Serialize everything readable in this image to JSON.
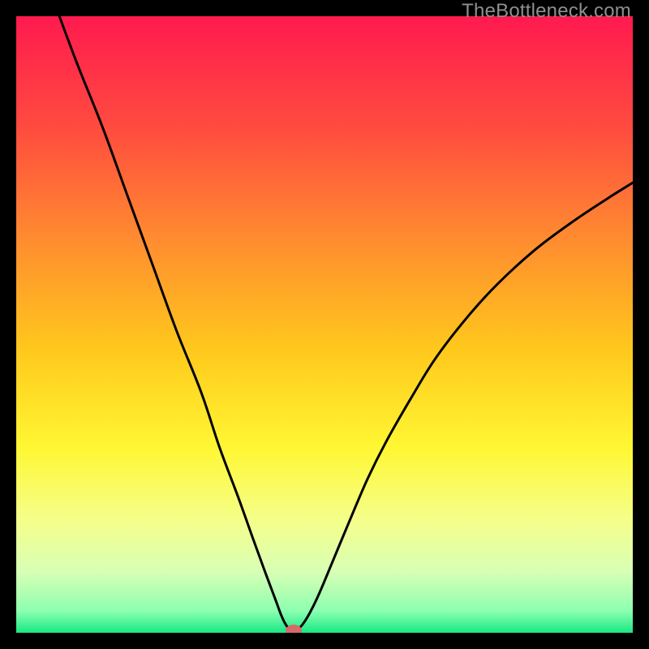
{
  "watermark": "TheBottleneck.com",
  "chart_data": {
    "type": "line",
    "title": "",
    "xlabel": "",
    "ylabel": "",
    "xlim": [
      0,
      100
    ],
    "ylim": [
      0,
      100
    ],
    "grid": false,
    "legend": false,
    "background_gradient": {
      "stops": [
        {
          "offset": 0.0,
          "color": "#ff1a4f"
        },
        {
          "offset": 0.18,
          "color": "#ff4b3f"
        },
        {
          "offset": 0.36,
          "color": "#ff8b30"
        },
        {
          "offset": 0.54,
          "color": "#ffc81c"
        },
        {
          "offset": 0.7,
          "color": "#fff733"
        },
        {
          "offset": 0.82,
          "color": "#f4ff8c"
        },
        {
          "offset": 0.9,
          "color": "#d9ffb5"
        },
        {
          "offset": 0.965,
          "color": "#8cffb0"
        },
        {
          "offset": 1.0,
          "color": "#17e884"
        }
      ]
    },
    "series": [
      {
        "name": "bottleneck-curve",
        "x": [
          7,
          10,
          14,
          18,
          22,
          26,
          30,
          33,
          36,
          38.5,
          40.5,
          42,
          43,
          43.8,
          44.6,
          45.4,
          46.4,
          47.6,
          49.2,
          51.5,
          54,
          57,
          60,
          64,
          68,
          73,
          78,
          84,
          90,
          96,
          100
        ],
        "y": [
          100,
          92,
          82,
          71,
          60,
          49,
          39,
          30,
          22,
          15,
          9.5,
          5.5,
          2.8,
          1.2,
          0.4,
          0.4,
          1.3,
          3.2,
          6.5,
          12,
          18,
          25,
          31,
          38,
          44.5,
          51,
          56.5,
          62,
          66.5,
          70.5,
          73
        ]
      }
    ],
    "marker": {
      "name": "optimal-point",
      "x": 45,
      "y": 0.4,
      "color": "#d46a6a",
      "rx": 10,
      "ry": 7
    }
  }
}
